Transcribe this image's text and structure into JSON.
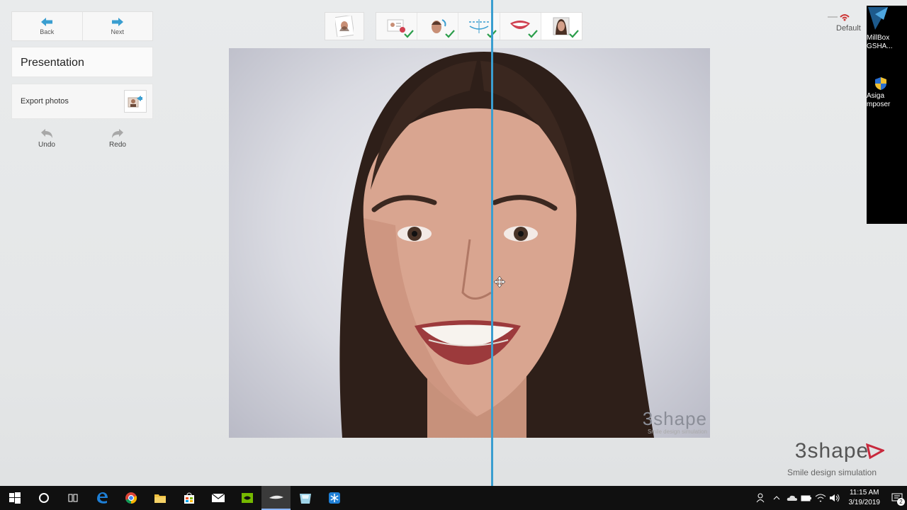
{
  "nav": {
    "back_label": "Back",
    "next_label": "Next"
  },
  "panel": {
    "title": "Presentation",
    "export_label": "Export photos",
    "undo_label": "Undo",
    "redo_label": "Redo"
  },
  "workflow": {
    "steps": [
      {
        "name": "import-photo",
        "done": false
      },
      {
        "name": "patient-info",
        "done": true
      },
      {
        "name": "face-alignment",
        "done": true
      },
      {
        "name": "smile-line",
        "done": true
      },
      {
        "name": "teeth-design",
        "done": true
      },
      {
        "name": "presentation",
        "done": true
      }
    ]
  },
  "photo": {
    "brand": "3shape",
    "subtitle": "Smile design simulation"
  },
  "app_logo": {
    "brand": "3shape",
    "subtitle": "Smile design simulation"
  },
  "desktop": {
    "default_label": "Default",
    "icon1": "MillBox\nGSHA...",
    "icon2": "Asiga\nmposer"
  },
  "taskbar": {
    "time": "11:15 AM",
    "date": "3/19/2019",
    "notification_count": "2"
  },
  "colors": {
    "accent": "#3a9ed0",
    "check": "#2a9d4a",
    "taskbar": "#101010"
  }
}
